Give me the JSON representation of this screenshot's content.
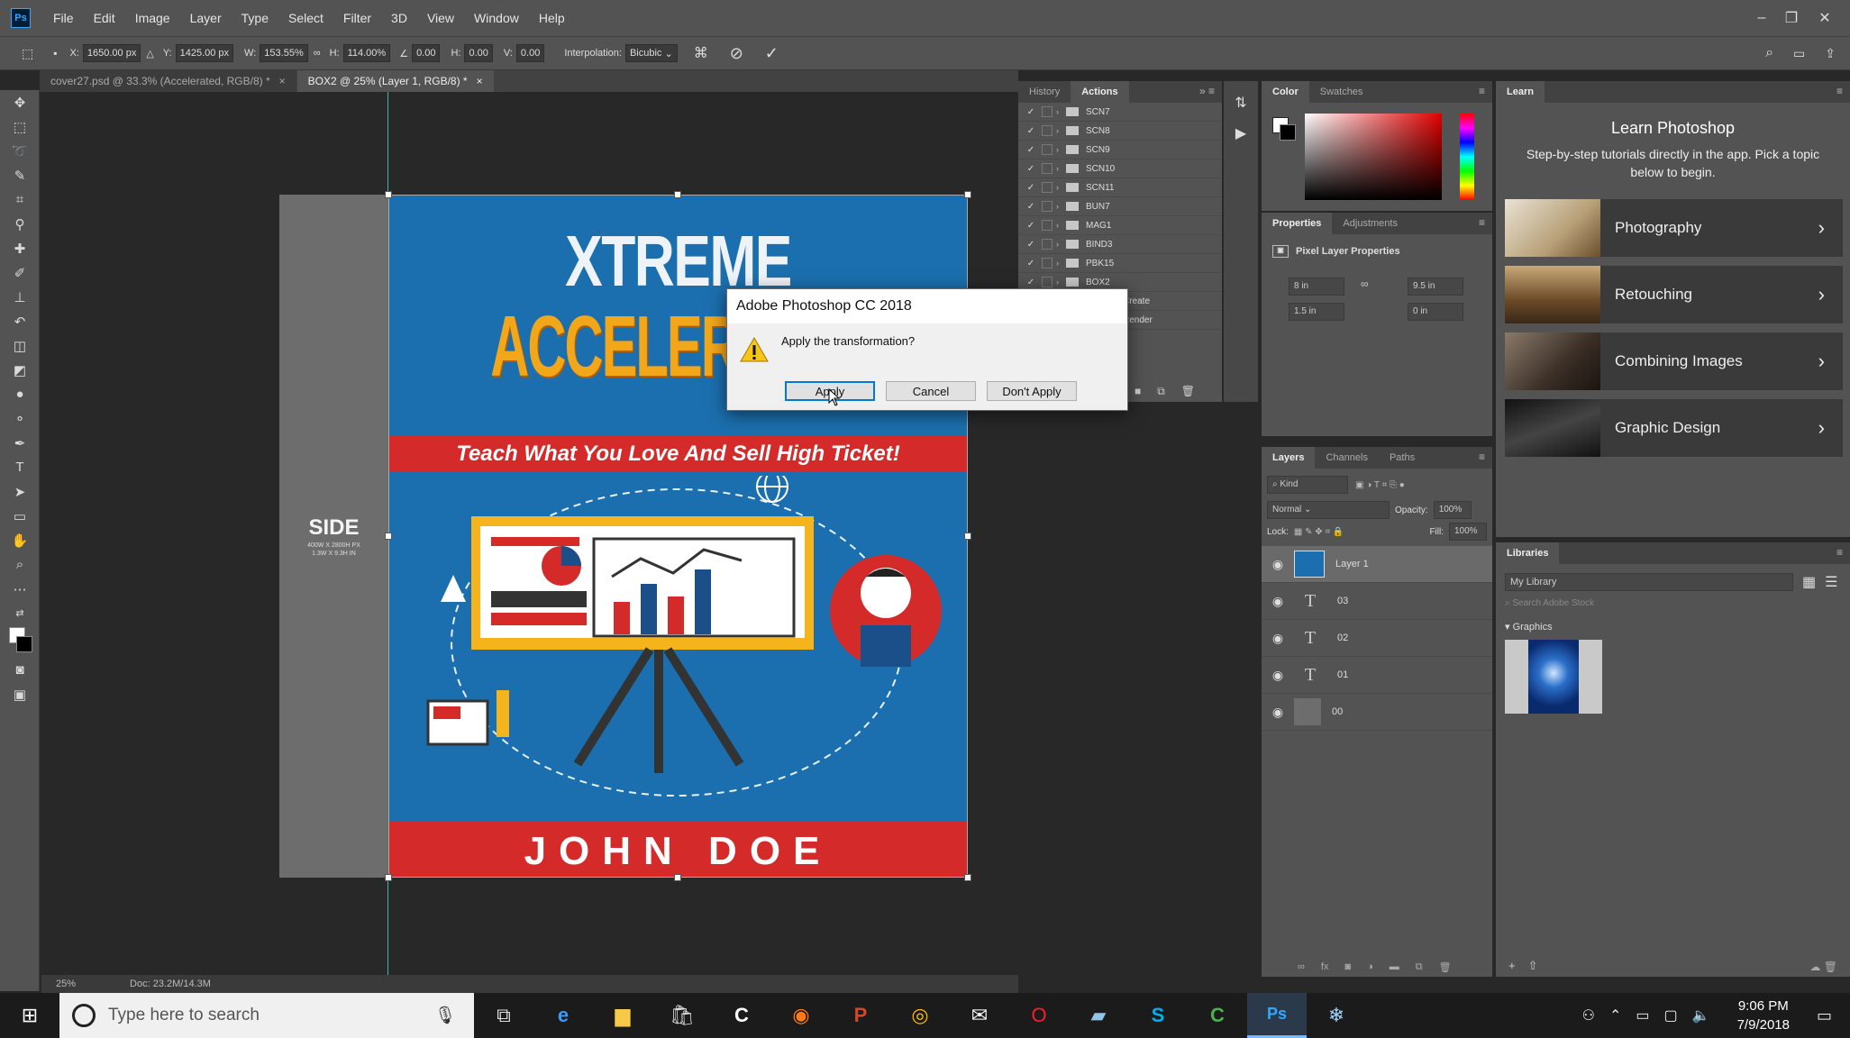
{
  "app": {
    "logo": "Ps",
    "menu": [
      "File",
      "Edit",
      "Image",
      "Layer",
      "Type",
      "Select",
      "Filter",
      "3D",
      "View",
      "Window",
      "Help"
    ]
  },
  "options": {
    "x_label": "X:",
    "x": "1650.00 px",
    "y_label": "Y:",
    "y": "1425.00 px",
    "w_label": "W:",
    "w": "153.55%",
    "h_label": "H:",
    "h": "114.00%",
    "angle": "0.00",
    "hskew_label": "H:",
    "hskew": "0.00",
    "vskew_label": "V:",
    "vskew": "0.00",
    "interp_label": "Interpolation:",
    "interp": "Bicubic"
  },
  "tabs": [
    {
      "label": "cover27.psd @ 33.3% (Accelerated, RGB/8) *",
      "close": "×"
    },
    {
      "label": "BOX2 @ 25% (Layer 1, RGB/8) *",
      "close": "×"
    }
  ],
  "canvas": {
    "side_title": "SIDE",
    "side_sub1": "400W X 2800H PX",
    "side_sub2": "1.3W X 9.3H IN",
    "cover_title1": "XTREME",
    "cover_title2": "ACCELERATED",
    "cover_tagline": "Teach What You Love And Sell High Ticket!",
    "cover_author": "JOHN DOE"
  },
  "status": {
    "zoom": "25%",
    "doc": "Doc: 23.2M/14.3M"
  },
  "history_panel": {
    "tabs": [
      "History",
      "Actions"
    ],
    "actions": [
      "SCN7",
      "SCN8",
      "SCN9",
      "SCN10",
      "SCN11",
      "BUN7",
      "MAG1",
      "BIND3",
      "PBK15",
      "BOX2"
    ],
    "sub_actions": [
      "Create",
      "Render"
    ]
  },
  "color_panel": {
    "tabs": [
      "Color",
      "Swatches"
    ]
  },
  "properties_panel": {
    "tabs": [
      "Properties",
      "Adjustments"
    ],
    "title": "Pixel Layer Properties",
    "w_val": "8 in",
    "h_val": "9.5 in",
    "x_val": "1.5 in",
    "y_val": "0 in"
  },
  "layers_panel": {
    "tabs": [
      "Layers",
      "Channels",
      "Paths"
    ],
    "kind": "Kind",
    "blend": "Normal",
    "opacity_label": "Opacity:",
    "opacity": "100%",
    "lock_label": "Lock:",
    "fill_label": "Fill:",
    "fill": "100%",
    "layers": [
      {
        "name": "Layer 1",
        "type": "image"
      },
      {
        "name": "03",
        "type": "text"
      },
      {
        "name": "02",
        "type": "text"
      },
      {
        "name": "01",
        "type": "text"
      },
      {
        "name": "00",
        "type": "fill"
      }
    ]
  },
  "learn_panel": {
    "tab": "Learn",
    "title": "Learn Photoshop",
    "subtitle": "Step-by-step tutorials directly in the app. Pick a topic below to begin.",
    "cards": [
      "Photography",
      "Retouching",
      "Combining Images",
      "Graphic Design"
    ]
  },
  "libraries_panel": {
    "tab": "Libraries",
    "library": "My Library",
    "search": "Search Adobe Stock",
    "section": "Graphics"
  },
  "dialog": {
    "title": "Adobe Photoshop CC 2018",
    "message": "Apply the transformation?",
    "apply": "Apply",
    "cancel": "Cancel",
    "dont_apply": "Don't Apply"
  },
  "taskbar": {
    "search_placeholder": "Type here to search",
    "time": "9:06 PM",
    "date": "7/9/2018"
  }
}
